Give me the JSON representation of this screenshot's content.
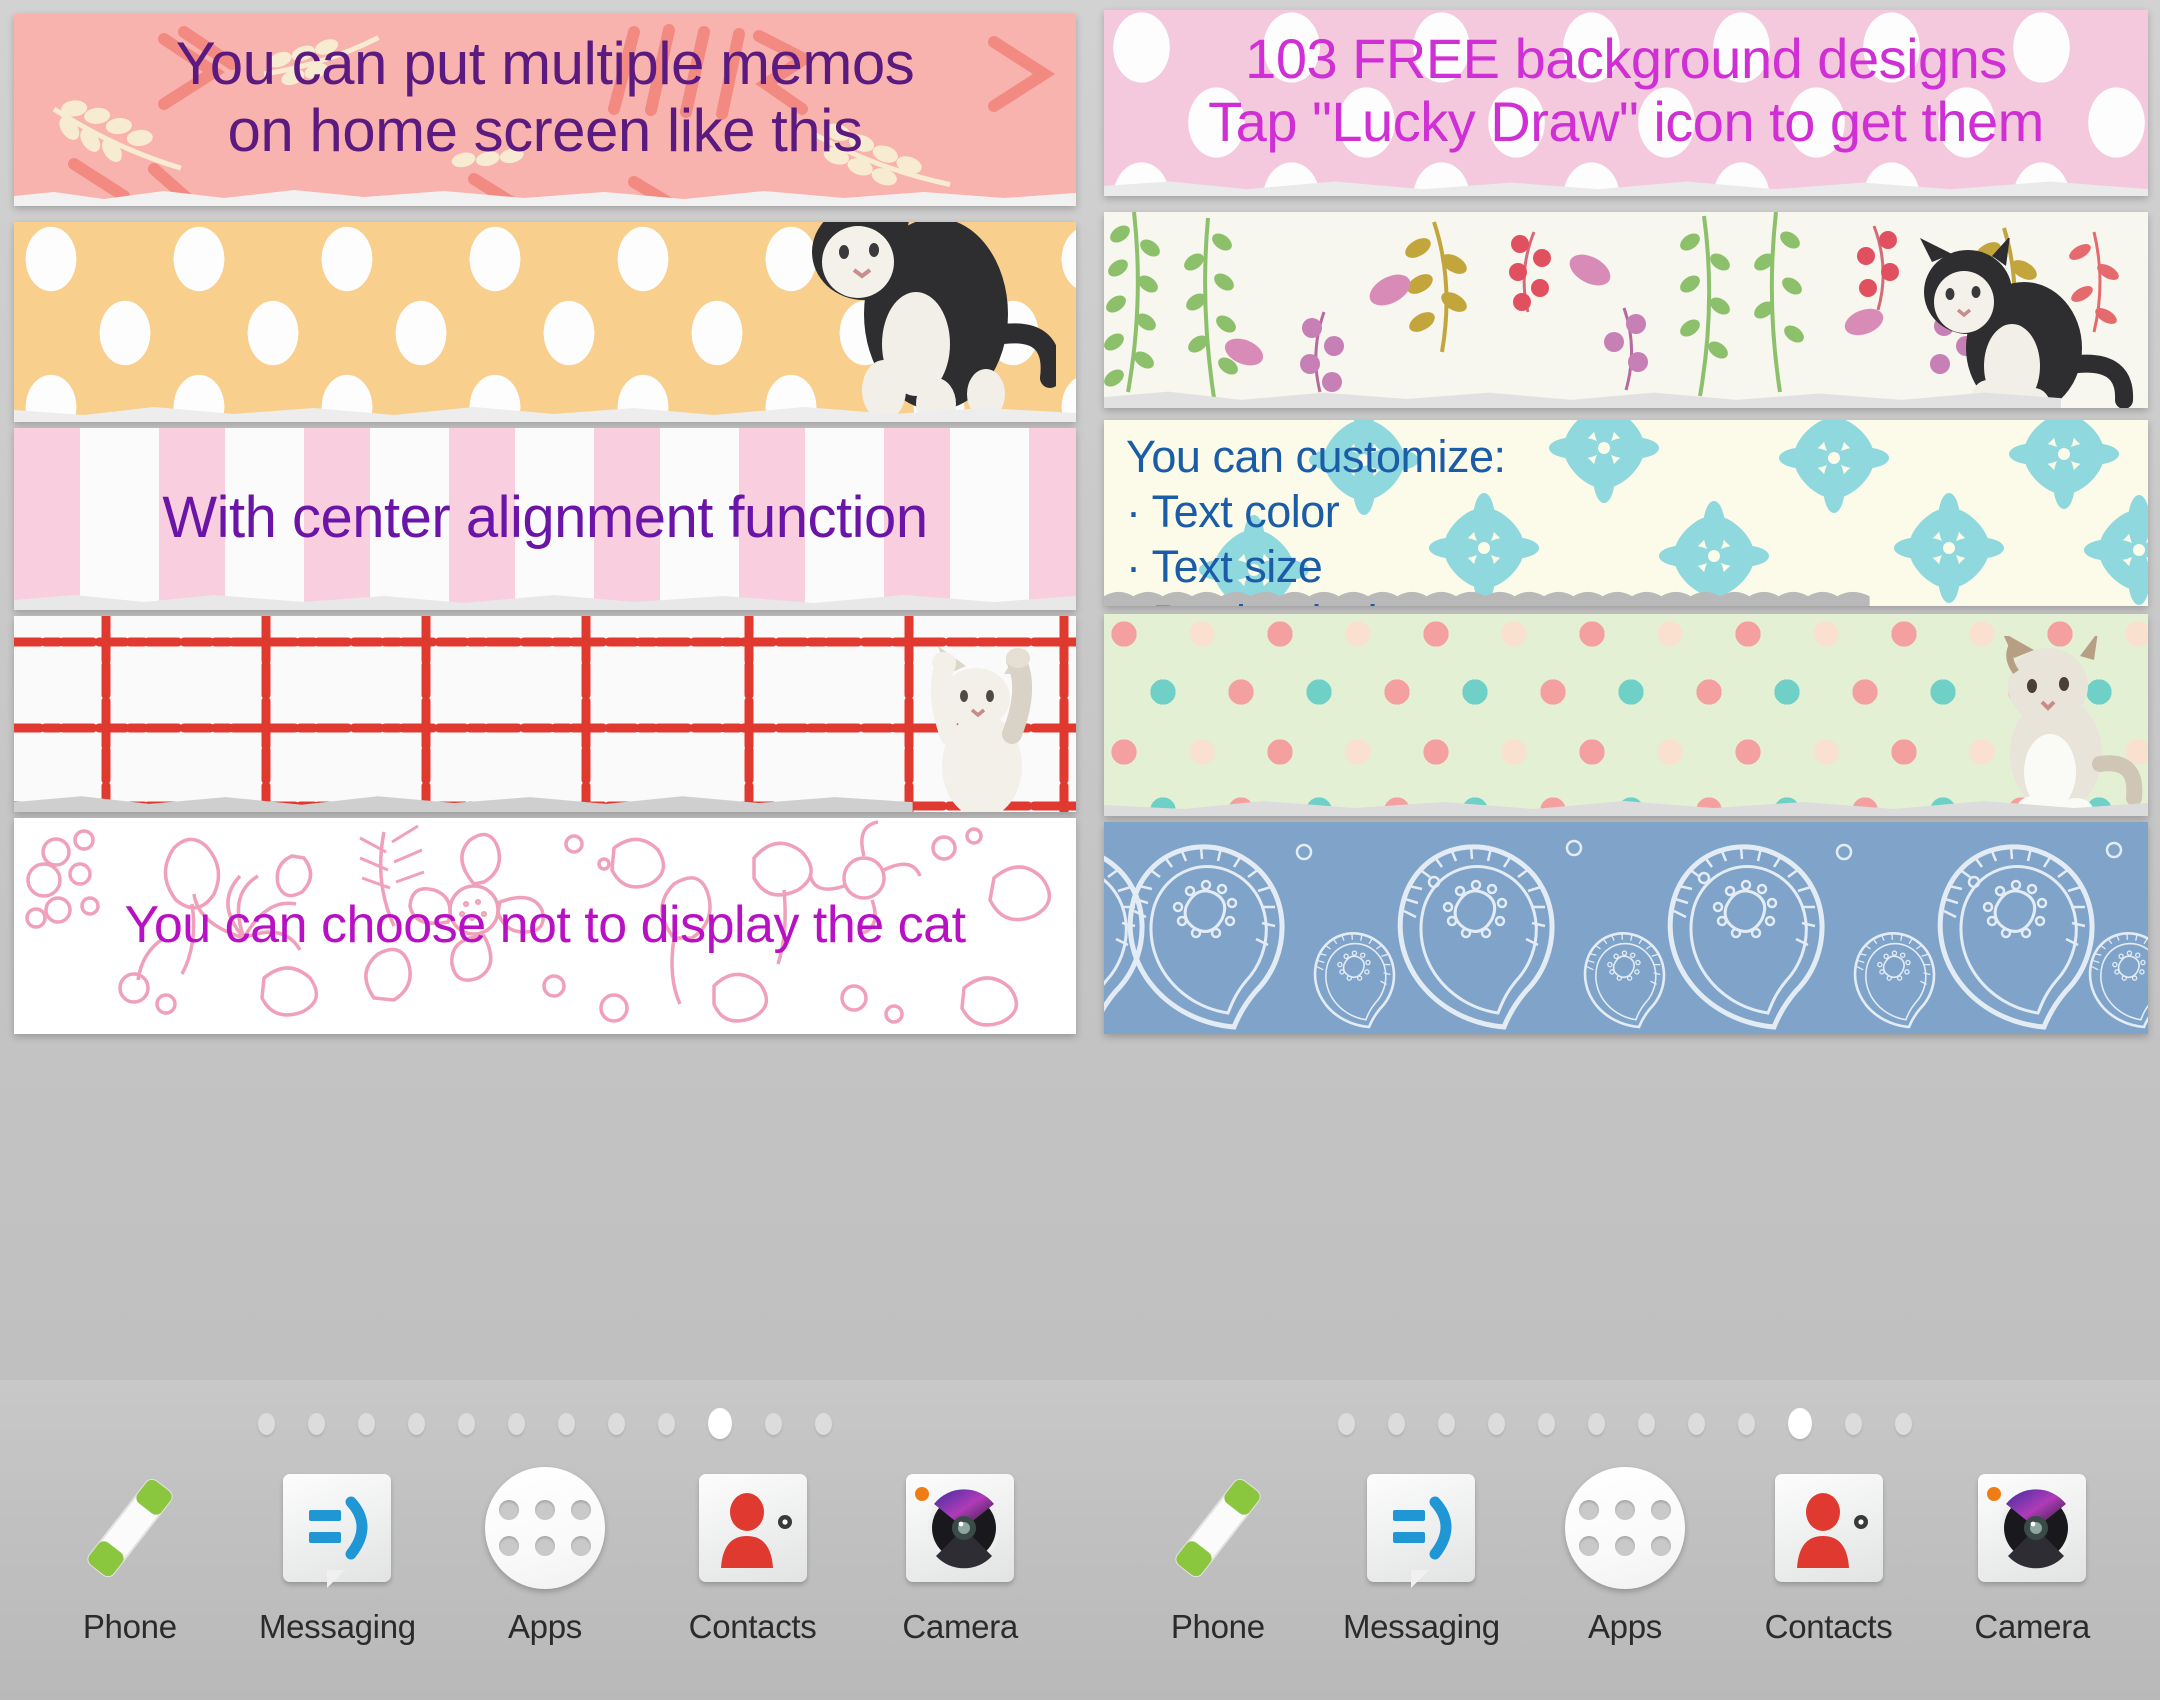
{
  "screens": [
    {
      "name": "left-home-screen",
      "memos": [
        {
          "id": "memo-multiple",
          "text": "You can put multiple memos\non home screen like this",
          "text_color": "#5b1a7f",
          "pattern": "pink-love-leaves",
          "align": "center"
        },
        {
          "id": "memo-dots-cat",
          "text": "",
          "text_color": "",
          "pattern": "orange-polka-dots",
          "align": "center"
        },
        {
          "id": "memo-center",
          "text": "With center alignment function",
          "text_color": "#6a15a8",
          "pattern": "pink-vertical-stripes",
          "align": "center"
        },
        {
          "id": "memo-grid",
          "text": "",
          "text_color": "",
          "pattern": "red-grid-paper",
          "align": "center"
        },
        {
          "id": "memo-nocat",
          "text": "You can choose not to display the cat",
          "text_color": "#b810c4",
          "pattern": "pink-floral-outline",
          "align": "center"
        }
      ],
      "dock": {
        "items": [
          {
            "icon": "phone-icon",
            "label": "Phone"
          },
          {
            "icon": "messaging-icon",
            "label": "Messaging"
          },
          {
            "icon": "apps-icon",
            "label": "Apps"
          },
          {
            "icon": "contacts-icon",
            "label": "Contacts"
          },
          {
            "icon": "camera-icon",
            "label": "Camera"
          }
        ]
      },
      "page_indicator": {
        "total": 12,
        "active_index": 9
      }
    },
    {
      "name": "right-home-screen",
      "memos": [
        {
          "id": "memo-free-bg",
          "text": "103 FREE background designs\nTap \"Lucky Draw\" icon to get them",
          "text_color": "#cf2fd4",
          "pattern": "light-pink-polka-dots",
          "align": "center"
        },
        {
          "id": "memo-botanical",
          "text": "",
          "text_color": "",
          "pattern": "botanical-berries",
          "align": "center"
        },
        {
          "id": "memo-customize",
          "text": "You can customize:\n· Text color\n· Text size\n· Border design",
          "text_color": "#1b5ca8",
          "pattern": "cream-teal-flowers",
          "align": "left"
        },
        {
          "id": "memo-multidot",
          "text": "",
          "text_color": "",
          "pattern": "green-multicolor-dots",
          "align": "center"
        },
        {
          "id": "memo-paisley",
          "text": "",
          "text_color": "",
          "pattern": "blue-paisley",
          "align": "center"
        }
      ],
      "dock": {
        "items": [
          {
            "icon": "phone-icon",
            "label": "Phone"
          },
          {
            "icon": "messaging-icon",
            "label": "Messaging"
          },
          {
            "icon": "apps-icon",
            "label": "Apps"
          },
          {
            "icon": "contacts-icon",
            "label": "Contacts"
          },
          {
            "icon": "camera-icon",
            "label": "Camera"
          }
        ]
      },
      "page_indicator": {
        "total": 12,
        "active_index": 9
      }
    }
  ],
  "colors": {
    "wallpaper": "#c6c6c6",
    "dock_bg": "#c2c2c2",
    "purple_text": "#5b1a7f",
    "magenta_text": "#b810c4",
    "blue_text": "#1b5ca8",
    "orange_card": "#f9cf8e",
    "pink_card": "#f9b3ae",
    "paisley_blue": "#7fa3c9"
  }
}
